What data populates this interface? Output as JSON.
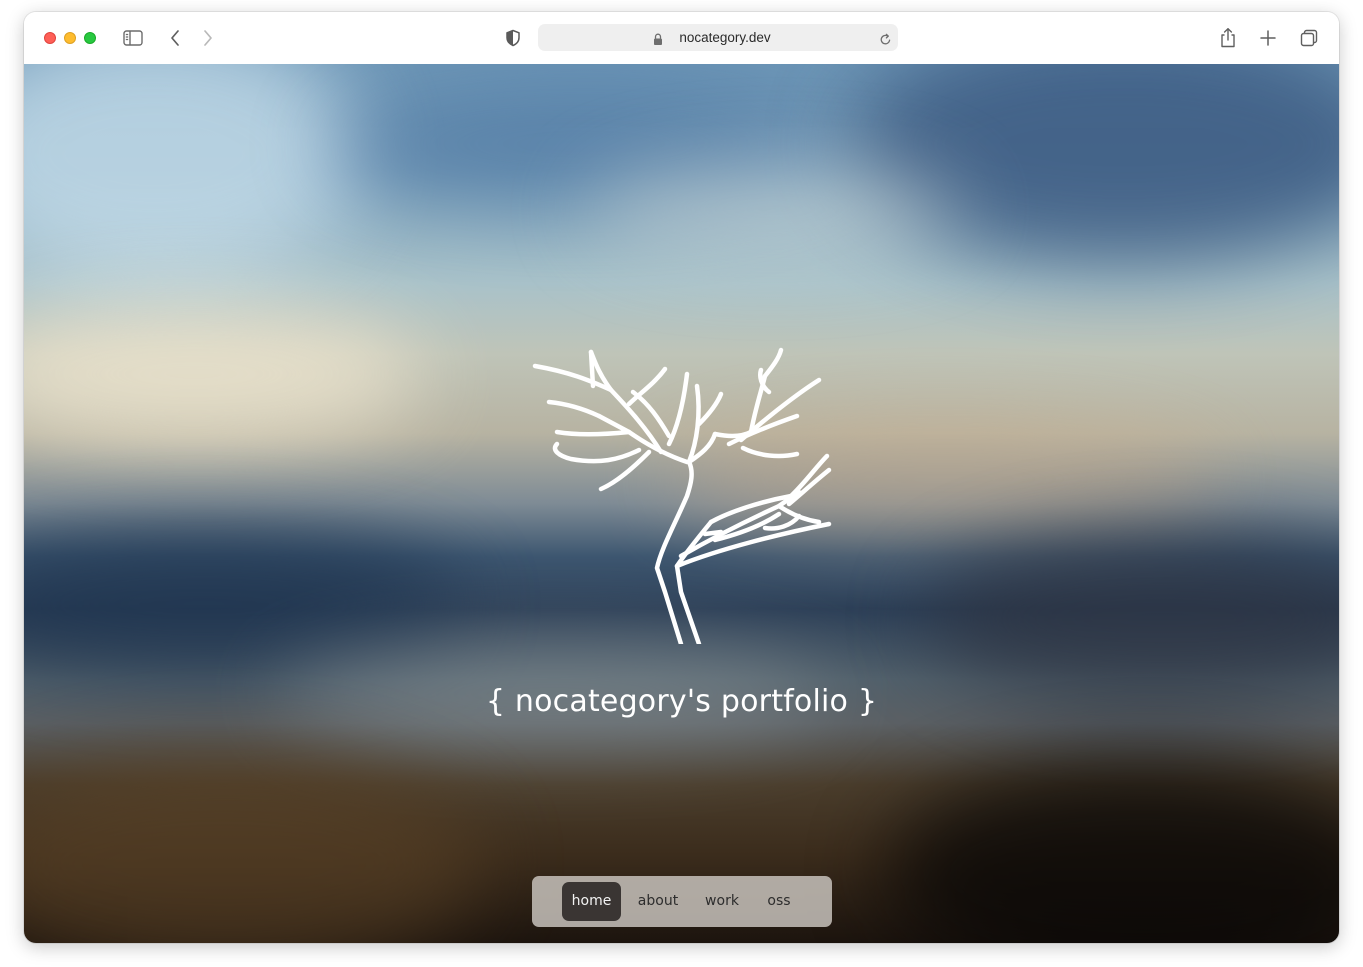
{
  "browser": {
    "url": "nocategory.dev"
  },
  "page": {
    "title": "{ nocategory's portfolio }",
    "nav": [
      {
        "label": "home",
        "active": true
      },
      {
        "label": "about",
        "active": false
      },
      {
        "label": "work",
        "active": false
      },
      {
        "label": "oss",
        "active": false
      }
    ]
  },
  "icons": {
    "sidebar": "sidebar-toggle-icon",
    "back": "chevron-left-icon",
    "forward": "chevron-right-icon",
    "privacy": "shield-icon",
    "lock": "lock-icon",
    "reload": "reload-icon",
    "share": "share-icon",
    "new_tab": "plus-icon",
    "tabs": "tab-overview-icon",
    "logo": "tree-logo-icon"
  },
  "colors": {
    "close": "#fe5f57",
    "minimize": "#febc2e",
    "maximize": "#28c840",
    "nav_active_bg": "#3a3533"
  }
}
